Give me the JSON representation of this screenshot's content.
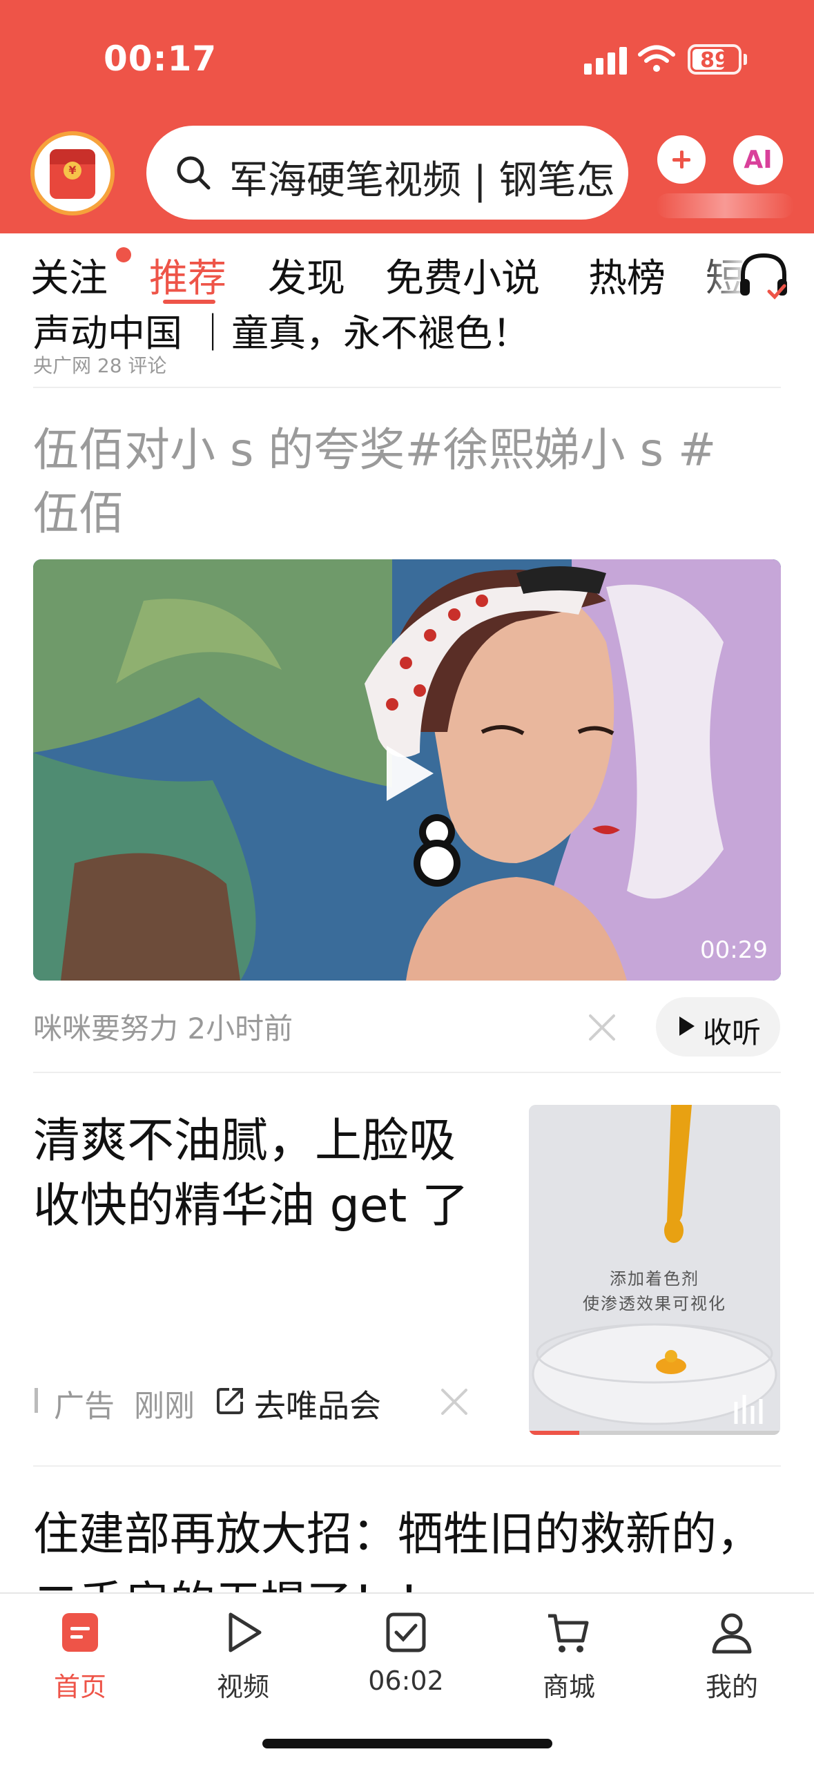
{
  "status_bar": {
    "time": "00:17",
    "battery": "89"
  },
  "header": {
    "search_text": "军海硬笔视频 | 钢笔怎",
    "ai_label": "AI"
  },
  "tabs": [
    {
      "label": "关注",
      "has_dot": true
    },
    {
      "label": "推荐",
      "active": true
    },
    {
      "label": "发现"
    },
    {
      "label": "免费小说"
    },
    {
      "label": "热榜"
    },
    {
      "label": "短"
    }
  ],
  "feed": {
    "prev_item": {
      "title": "声动中国 ｜童真，永不褪色！",
      "meta": "央广网   28 评论"
    },
    "video_item": {
      "title": "伍佰对小 s 的夸奖#徐熙娣小 s #伍佰",
      "duration": "00:29",
      "meta": "咪咪要努力  2小时前",
      "listen_label": "收听"
    },
    "ad_item": {
      "title": "清爽不油腻，上脸吸收快的精华油 get 了",
      "label": "广告",
      "time": "刚刚",
      "link": "去唯品会",
      "thumb_text_1": "添加着色剂",
      "thumb_text_2": "使渗透效果可视化",
      "progress": 0.2
    },
    "next_item": {
      "title": "住建部再放大招：牺牲旧的救新的，二手房的无提了！！"
    }
  },
  "tabbar": [
    {
      "label": "首页",
      "icon": "home-icon",
      "active": true
    },
    {
      "label": "视频",
      "icon": "video-play-icon"
    },
    {
      "label": "06:02",
      "icon": "checkin-icon"
    },
    {
      "label": "商城",
      "icon": "cart-icon"
    },
    {
      "label": "我的",
      "icon": "profile-icon"
    }
  ],
  "colors": {
    "brand": "#ee5448",
    "muted_text": "#999999"
  }
}
